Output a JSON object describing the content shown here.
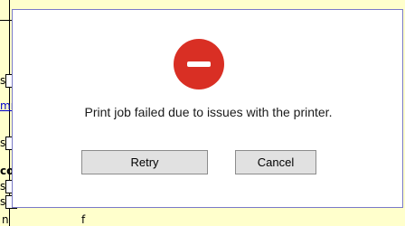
{
  "background": {
    "fragments": [
      "s",
      "mm",
      "s",
      "co",
      "s",
      "s",
      "n",
      "f"
    ],
    "color": "#ffffcc"
  },
  "dialog": {
    "icon": "error-minus-icon",
    "icon_color": "#d92f24",
    "message": "Print job failed due to issues with the printer.",
    "buttons": {
      "retry_label": "Retry",
      "cancel_label": "Cancel"
    }
  }
}
